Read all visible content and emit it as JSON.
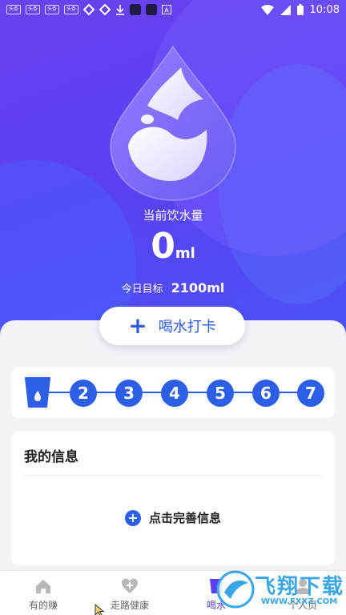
{
  "status_bar": {
    "left_chips": [
      "头条",
      "头条",
      "头条",
      "头条"
    ],
    "time": "10:08"
  },
  "hero": {
    "current_label": "当前饮水量",
    "amount_value": "0",
    "amount_unit": "ml",
    "target_label": "今日目标",
    "target_value": "2100ml"
  },
  "checkin": {
    "label": "喝水打卡"
  },
  "days": [
    "2",
    "3",
    "4",
    "5",
    "6",
    "7"
  ],
  "info": {
    "title": "我的信息",
    "complete_label": "点击完善信息"
  },
  "tabs": [
    {
      "label": "有的赚",
      "icon": "home-icon"
    },
    {
      "label": "走路健康",
      "icon": "heart-plus-icon"
    },
    {
      "label": "喝水",
      "icon": "cup-icon"
    },
    {
      "label": "个人页",
      "icon": "user-icon"
    }
  ],
  "watermark": {
    "text": "飞翔下载",
    "sub": "WWW.FXXZ.COM"
  },
  "colors": {
    "accent": "#2d5fe6",
    "hero_start": "#6a42f0",
    "hero_end": "#4a55f5"
  }
}
